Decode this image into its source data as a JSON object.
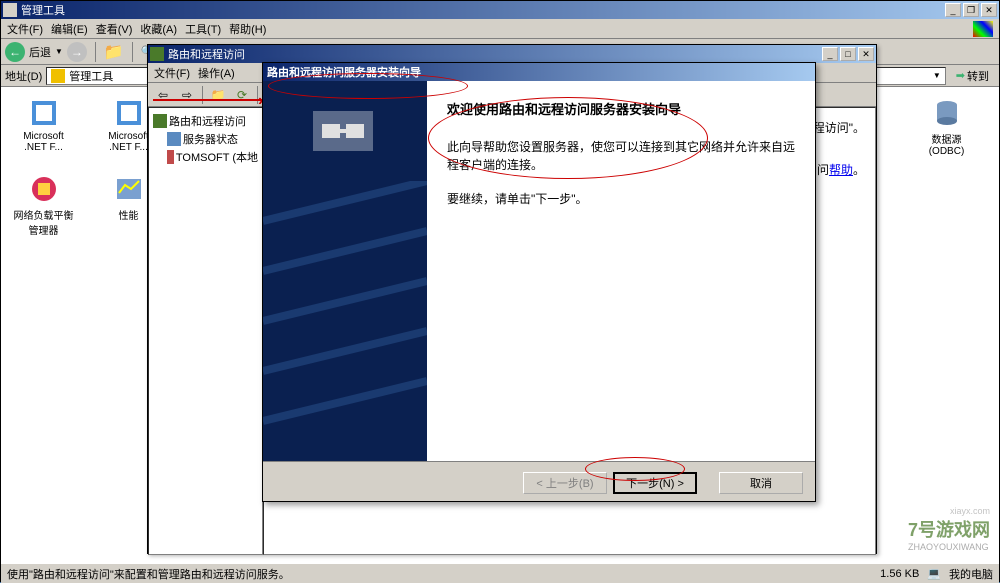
{
  "admin": {
    "title": "管理工具",
    "menu": {
      "file": "文件(F)",
      "edit": "编辑(E)",
      "view": "查看(V)",
      "favorites": "收藏(A)",
      "tools": "工具(T)",
      "help": "帮助(H)"
    },
    "back": "后退",
    "address_label": "地址(D)",
    "address_value": "管理工具",
    "goto": "转到"
  },
  "icons": {
    "msnet1": "Microsoft .NET F...",
    "msnet2": "Microsoft .NET F...",
    "nlb": "网络负载平衡管理器",
    "perf": "性能",
    "odbc": "数据源 (ODBC)"
  },
  "mmc": {
    "title": "路由和远程访问",
    "menu": {
      "file": "文件(F)",
      "action": "操作(A)"
    },
    "tree": {
      "root": "路由和远程访问",
      "status": "服务器状态",
      "server": "TOMSOFT (本地"
    },
    "right": {
      "line1": "程访问\"。",
      "line2": "问",
      "help": "帮助"
    }
  },
  "wizard": {
    "title": "路由和远程访问服务器安装向导",
    "heading": "欢迎使用路由和远程访问服务器安装向导",
    "p1": "此向导帮助您设置服务器，使您可以连接到其它网络并允许来自远程客户端的连接。",
    "p2": "要继续，请单击\"下一步\"。",
    "back": "< 上一步(B)",
    "next": "下一步(N) >",
    "cancel": "取消"
  },
  "statusbar": {
    "text": "使用\"路由和远程访问\"来配置和管理路由和远程访问服务。",
    "size": "1.56 KB",
    "mycomputer": "我的电脑"
  },
  "watermark": {
    "brand": "7号游戏网",
    "url": "xiayx.com",
    "sub": "ZHAOYOUXIWANG"
  }
}
